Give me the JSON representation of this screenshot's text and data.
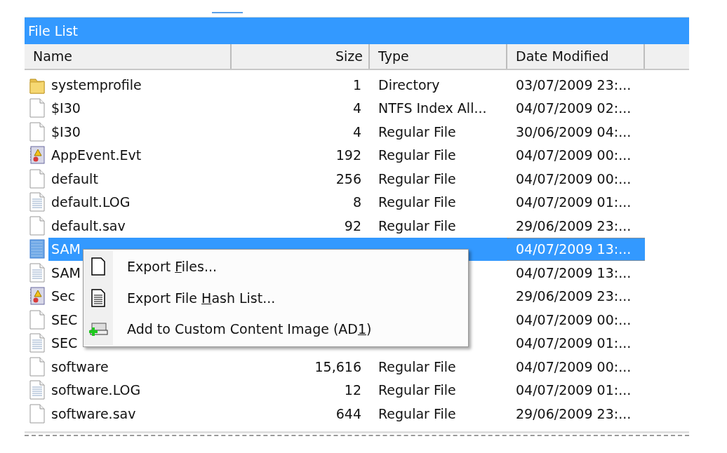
{
  "panel": {
    "title": "File List"
  },
  "table": {
    "columns": [
      {
        "label": "Name"
      },
      {
        "label": "Size"
      },
      {
        "label": "Type"
      },
      {
        "label": "Date Modified"
      }
    ],
    "rows": [
      {
        "kind": "folder",
        "selected": false,
        "name": "systemprofile",
        "size": "1",
        "type": "Directory",
        "date": "03/07/2009 23:..."
      },
      {
        "kind": "file",
        "selected": false,
        "name": "$I30",
        "size": "4",
        "type": "NTFS Index All...",
        "date": "04/07/2009 02:..."
      },
      {
        "kind": "file",
        "selected": false,
        "name": "$I30",
        "size": "4",
        "type": "Regular File",
        "date": "30/06/2009 04:..."
      },
      {
        "kind": "eventlog",
        "selected": false,
        "name": "AppEvent.Evt",
        "size": "192",
        "type": "Regular File",
        "date": "04/07/2009 00:..."
      },
      {
        "kind": "file",
        "selected": false,
        "name": "default",
        "size": "256",
        "type": "Regular File",
        "date": "04/07/2009 00:..."
      },
      {
        "kind": "text",
        "selected": false,
        "name": "default.LOG",
        "size": "8",
        "type": "Regular File",
        "date": "04/07/2009 01:..."
      },
      {
        "kind": "file",
        "selected": false,
        "name": "default.sav",
        "size": "92",
        "type": "Regular File",
        "date": "29/06/2009 23:..."
      },
      {
        "kind": "file",
        "selected": true,
        "name": "SAM",
        "date": "04/07/2009 13:..."
      },
      {
        "kind": "text",
        "selected": false,
        "name": "SAM",
        "date": "04/07/2009 13:..."
      },
      {
        "kind": "eventlog",
        "selected": false,
        "name": "Sec",
        "date": "29/06/2009 23:..."
      },
      {
        "kind": "file",
        "selected": false,
        "name": "SEC",
        "date": "04/07/2009 00:..."
      },
      {
        "kind": "text",
        "selected": false,
        "name": "SEC",
        "date": "04/07/2009 01:..."
      },
      {
        "kind": "file",
        "selected": false,
        "name": "software",
        "size": "15,616",
        "type": "Regular File",
        "date": "04/07/2009 00:..."
      },
      {
        "kind": "text",
        "selected": false,
        "name": "software.LOG",
        "size": "12",
        "type": "Regular File",
        "date": "04/07/2009 01:..."
      },
      {
        "kind": "file",
        "selected": false,
        "name": "software.sav",
        "size": "644",
        "type": "Regular File",
        "date": "29/06/2009 23:..."
      }
    ]
  },
  "context_menu": {
    "items": [
      {
        "kind": "page",
        "label": [
          "Export ",
          "F",
          "iles..."
        ]
      },
      {
        "kind": "list",
        "label": [
          "Export File ",
          "H",
          "ash List..."
        ]
      },
      {
        "kind": "add",
        "label": [
          "Add to Custom Content Image (AD",
          "1",
          ")"
        ]
      }
    ]
  }
}
